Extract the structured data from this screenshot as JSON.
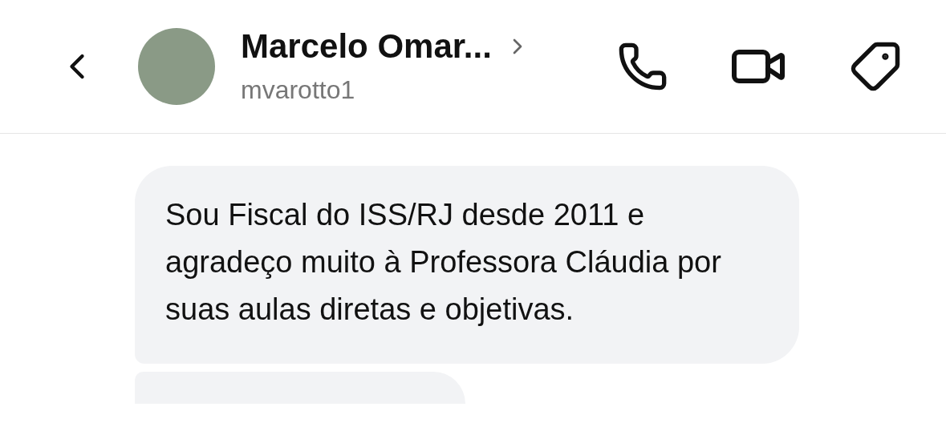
{
  "header": {
    "name": "Marcelo Omar...",
    "username": "mvarotto1"
  },
  "messages": [
    "Sou Fiscal do ISS/RJ desde 2011 e agradeço muito à Professora Cláudia por suas aulas diretas e objetivas."
  ]
}
